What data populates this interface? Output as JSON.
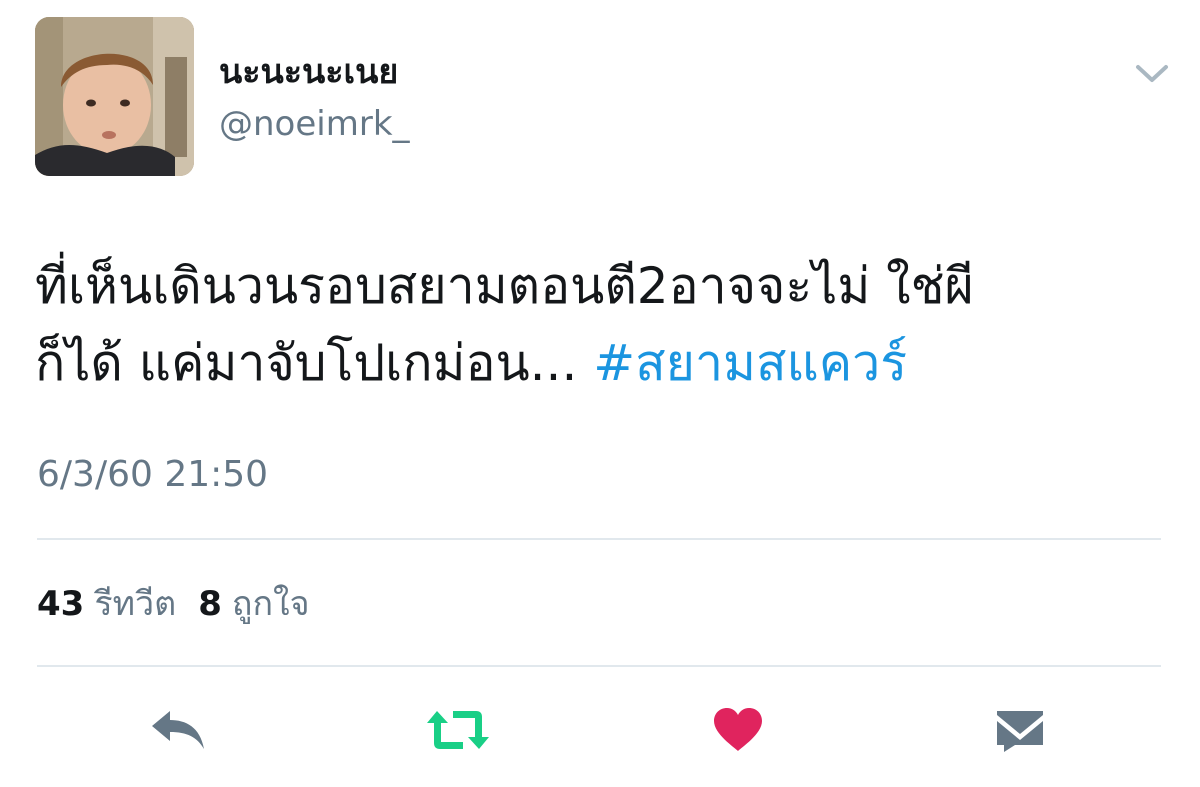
{
  "user": {
    "display_name": "นะนะนะเนย",
    "handle": "@noeimrk_"
  },
  "tweet": {
    "line1": "ที่เห็นเดินวนรอบสยามตอนตี2อาจจะไม่ ใช่ผี",
    "line2": "ก็ได้ แค่มาจับโปเกม่อน...",
    "hashtag": "#สยามสแควร์",
    "timestamp": "6/3/60 21:50"
  },
  "stats": {
    "retweets_count": "43",
    "retweets_label": "รีทวีต",
    "likes_count": "8",
    "likes_label": "ถูกใจ"
  },
  "icons": {
    "caret": "chevron-down-icon",
    "reply": "reply-icon",
    "retweet": "retweet-icon",
    "like": "heart-icon",
    "message": "envelope-icon"
  },
  "colors": {
    "text": "#14171a",
    "secondary": "#657786",
    "link": "#1b95e0",
    "retweet_active": "#19cf86",
    "like_active": "#e0245e",
    "divider": "#e1e8ed"
  }
}
